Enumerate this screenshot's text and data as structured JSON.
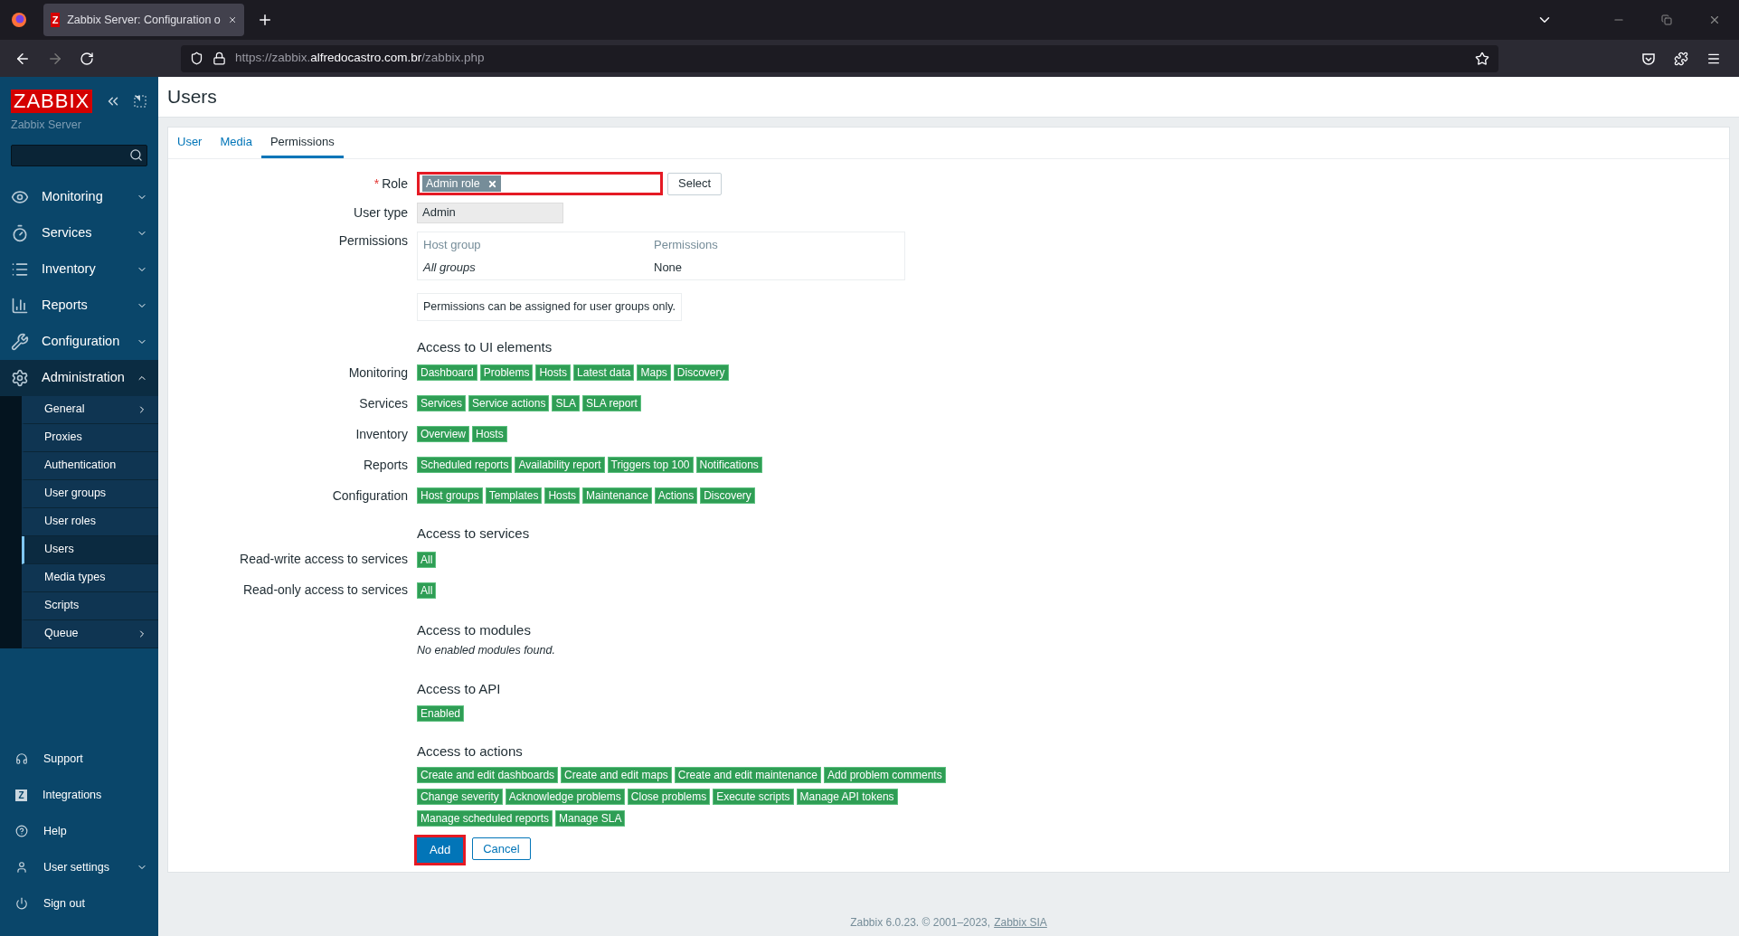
{
  "browser": {
    "tab": {
      "favicon": "Z",
      "title": "Zabbix Server: Configuration o",
      "selected": true
    },
    "url": {
      "prefix": "https://zabbix.",
      "domain": "alfredocastro.com.br",
      "path": "/zabbix.php"
    }
  },
  "sidebar": {
    "logo": "ZABBIX",
    "server": "Zabbix Server",
    "menu": [
      {
        "kind": "eye",
        "label": "Monitoring",
        "expanded": false
      },
      {
        "kind": "timer",
        "label": "Services",
        "expanded": false
      },
      {
        "kind": "list",
        "label": "Inventory",
        "expanded": false
      },
      {
        "kind": "chart",
        "label": "Reports",
        "expanded": false
      },
      {
        "kind": "wrench",
        "label": "Configuration",
        "expanded": false
      },
      {
        "kind": "gear",
        "label": "Administration",
        "expanded": true,
        "children": [
          {
            "label": "General",
            "submenu": true,
            "selected": false
          },
          {
            "label": "Proxies",
            "submenu": false,
            "selected": false
          },
          {
            "label": "Authentication",
            "submenu": false,
            "selected": false
          },
          {
            "label": "User groups",
            "submenu": false,
            "selected": false
          },
          {
            "label": "User roles",
            "submenu": false,
            "selected": false
          },
          {
            "label": "Users",
            "submenu": false,
            "selected": true
          },
          {
            "label": "Media types",
            "submenu": false,
            "selected": false
          },
          {
            "label": "Scripts",
            "submenu": false,
            "selected": false
          },
          {
            "label": "Queue",
            "submenu": true,
            "selected": false
          }
        ]
      }
    ],
    "bottom": [
      {
        "kind": "headset",
        "label": "Support",
        "expandable": false
      },
      {
        "kind": "integrations",
        "icon_text": "Z",
        "label": "Integrations",
        "expandable": false
      },
      {
        "kind": "help",
        "label": "Help",
        "expandable": false
      },
      {
        "kind": "user",
        "label": "User settings",
        "expandable": true
      },
      {
        "kind": "power",
        "label": "Sign out",
        "expandable": false
      }
    ]
  },
  "page": {
    "title": "Users",
    "tabs": [
      {
        "label": "User",
        "selected": false
      },
      {
        "label": "Media",
        "selected": false
      },
      {
        "label": "Permissions",
        "selected": true
      }
    ],
    "role": {
      "label": "Role",
      "required": true,
      "required_mark": "*",
      "chip": "Admin role",
      "highlighted": true,
      "button": "Select"
    },
    "user_type": {
      "label": "User type",
      "value": "Admin"
    },
    "permissions": {
      "label": "Permissions",
      "columns": [
        "Host group",
        "Permissions"
      ],
      "rows": [
        [
          "All groups",
          "None"
        ]
      ],
      "note": "Permissions can be assigned for user groups only."
    },
    "ui_elements": {
      "heading": "Access to UI elements",
      "rows": [
        {
          "label": "Monitoring",
          "tags": [
            "Dashboard",
            "Problems",
            "Hosts",
            "Latest data",
            "Maps",
            "Discovery"
          ]
        },
        {
          "label": "Services",
          "tags": [
            "Services",
            "Service actions",
            "SLA",
            "SLA report"
          ]
        },
        {
          "label": "Inventory",
          "tags": [
            "Overview",
            "Hosts"
          ]
        },
        {
          "label": "Reports",
          "tags": [
            "Scheduled reports",
            "Availability report",
            "Triggers top 100",
            "Notifications"
          ]
        },
        {
          "label": "Configuration",
          "tags": [
            "Host groups",
            "Templates",
            "Hosts",
            "Maintenance",
            "Actions",
            "Discovery"
          ]
        }
      ]
    },
    "services": {
      "heading": "Access to services",
      "rows": [
        {
          "label": "Read-write access to services",
          "tags": [
            "All"
          ]
        },
        {
          "label": "Read-only access to services",
          "tags": [
            "All"
          ]
        }
      ]
    },
    "modules": {
      "heading": "Access to modules",
      "text": "No enabled modules found."
    },
    "api": {
      "heading": "Access to API",
      "tags": [
        "Enabled"
      ]
    },
    "actions": {
      "heading": "Access to actions",
      "lines": [
        [
          "Create and edit dashboards",
          "Create and edit maps",
          "Create and edit maintenance",
          "Add problem comments"
        ],
        [
          "Change severity",
          "Acknowledge problems",
          "Close problems",
          "Execute scripts",
          "Manage API tokens"
        ],
        [
          "Manage scheduled reports",
          "Manage SLA"
        ]
      ]
    },
    "buttons": {
      "add": "Add",
      "add_highlighted": true,
      "cancel": "Cancel"
    }
  },
  "footer": {
    "text": "Zabbix 6.0.23. © 2001–2023,",
    "link": "Zabbix SIA"
  }
}
